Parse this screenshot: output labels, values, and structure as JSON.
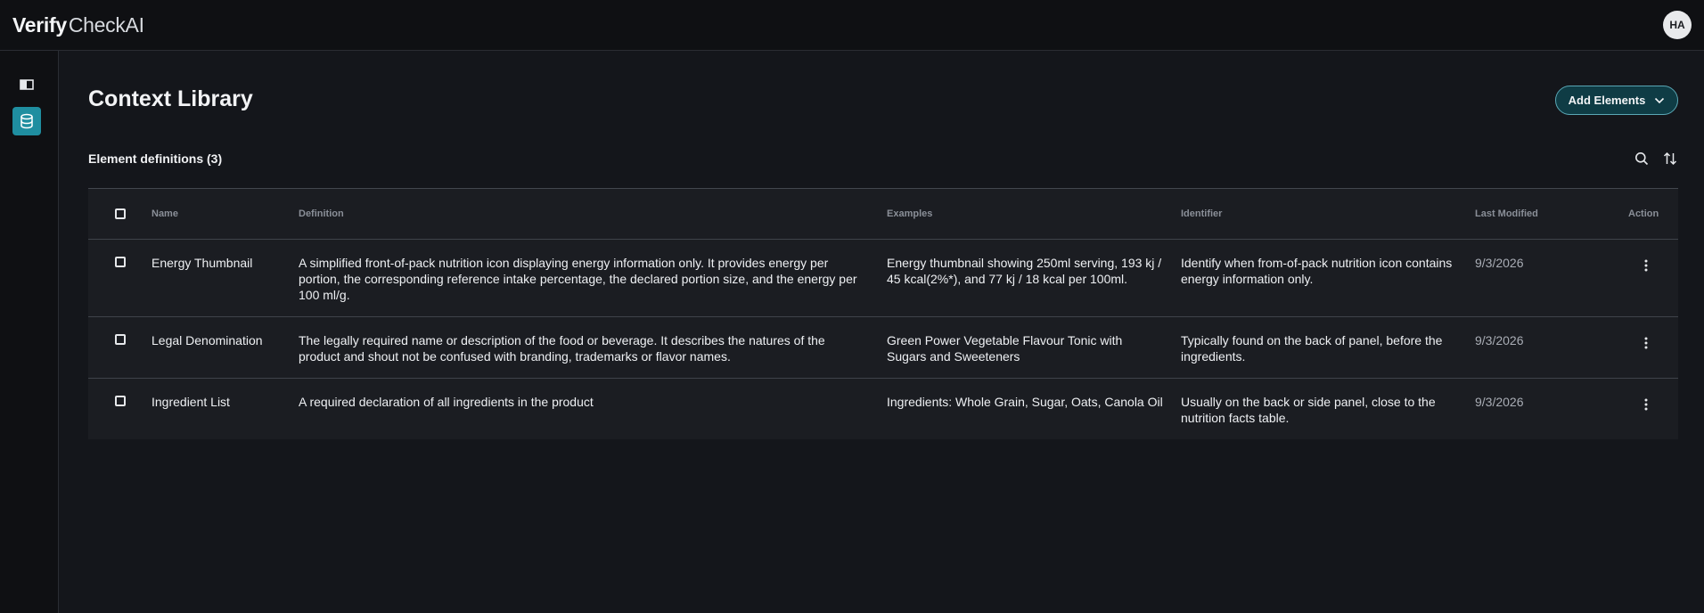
{
  "brand": {
    "bold": "Verify",
    "light": "CheckAI"
  },
  "user": {
    "initials": "HA"
  },
  "sidebar": {
    "items": [
      {
        "icon": "book-icon",
        "active": false
      },
      {
        "icon": "database-icon",
        "active": true
      }
    ]
  },
  "page": {
    "title": "Context Library",
    "add_button_label": "Add Elements"
  },
  "section": {
    "title": "Element definitions (3)"
  },
  "table": {
    "columns": [
      "Name",
      "Definition",
      "Examples",
      "Identifier",
      "Last Modified",
      "Action"
    ],
    "rows": [
      {
        "name": "Energy Thumbnail",
        "definition": "A simplified front-of-pack nutrition icon displaying energy information only. It provides energy per portion, the corresponding reference intake percentage, the declared portion size, and the energy per 100 ml/g.",
        "examples": "Energy thumbnail showing 250ml serving, 193 kj / 45 kcal(2%*), and 77 kj / 18 kcal per 100ml.",
        "identifier": "Identify when from-of-pack nutrition icon contains energy information only.",
        "last_modified": "9/3/2026"
      },
      {
        "name": "Legal Denomination",
        "definition": "The legally required name or description of the food or beverage. It describes the natures of the product and shout not be confused with branding, trademarks or flavor names.",
        "examples": "Green Power Vegetable Flavour Tonic with Sugars and Sweeteners",
        "identifier": "Typically found on the back of panel, before the ingredients.",
        "last_modified": "9/3/2026"
      },
      {
        "name": "Ingredient List",
        "definition": "A required declaration of all ingredients in the product",
        "examples": "Ingredients: Whole Grain, Sugar, Oats, Canola Oil",
        "identifier": "Usually on the back or side panel, close to the nutrition facts table.",
        "last_modified": "9/3/2026"
      }
    ]
  },
  "colors": {
    "accent": "#1f8ea0",
    "button_bg": "#0f3c45",
    "background": "#14161b"
  }
}
